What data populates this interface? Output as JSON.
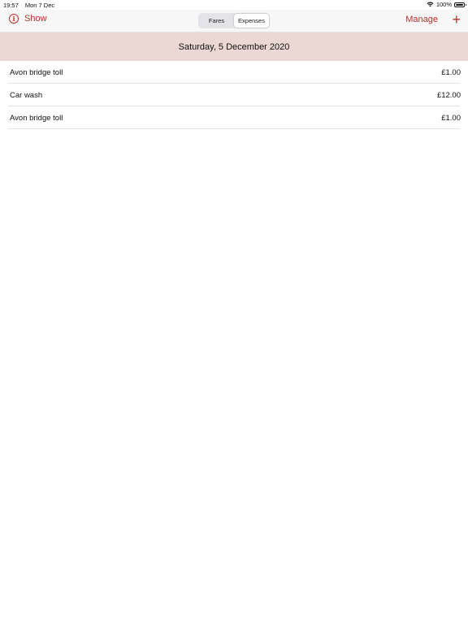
{
  "status_bar": {
    "time": "19:57",
    "date": "Mon 7 Dec",
    "wifi_icon": "wifi-icon",
    "battery": "100%",
    "battery_icon": "battery-icon"
  },
  "nav": {
    "show_label": "Show",
    "show_icon": "info-icon",
    "segments": [
      "Fares",
      "Expenses"
    ],
    "selected_segment": "Expenses",
    "manage_label": "Manage",
    "add_icon": "plus-icon",
    "add_label": "+"
  },
  "section": {
    "date": "Saturday, 5 December 2020"
  },
  "expenses": [
    {
      "name": "Avon bridge toll",
      "amount": "£1.00"
    },
    {
      "name": "Car wash",
      "amount": "£12.00"
    },
    {
      "name": "Avon bridge toll",
      "amount": "£1.00"
    }
  ],
  "colors": {
    "accent": "#b5322b",
    "section_header_bg": "#ebd7d4",
    "nav_bg": "#f7f7f7"
  }
}
